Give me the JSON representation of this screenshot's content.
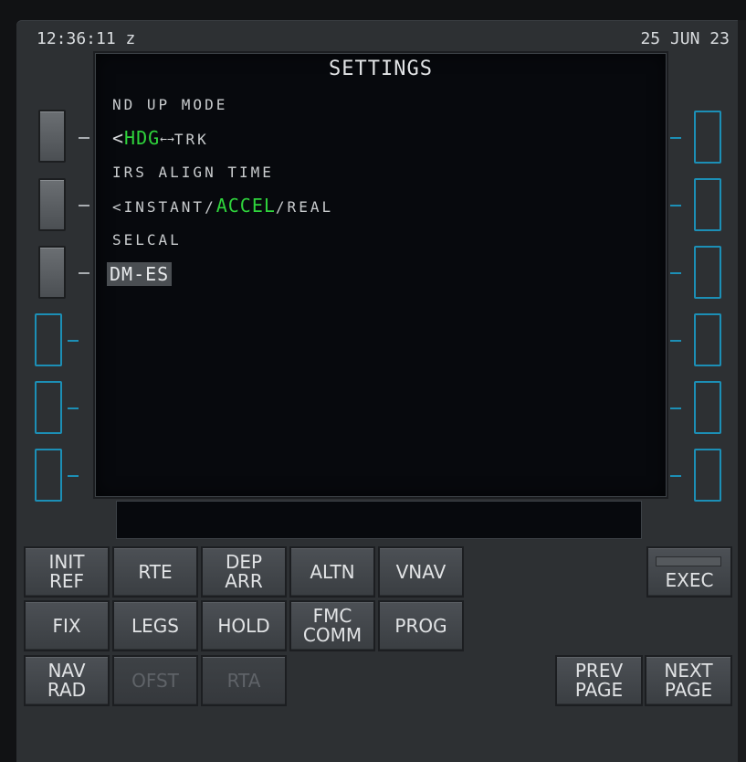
{
  "header": {
    "time": "12:36:11 z",
    "date": "25 JUN 23"
  },
  "screen": {
    "title": "SETTINGS",
    "nd_up_mode_label": "ND UP MODE",
    "nd_prefix": "<",
    "nd_hdg": "HDG",
    "nd_arrow": "←→",
    "nd_trk": "TRK",
    "irs_label": "IRS ALIGN TIME",
    "irs_prefix": "<INSTANT/",
    "irs_accel": "ACCEL",
    "irs_suffix": "/REAL",
    "selcal_label": "SELCAL",
    "selcal_value": "DM-ES"
  },
  "scratchpad": {
    "text": ""
  },
  "keys": {
    "init_ref": "INIT\nREF",
    "rte": "RTE",
    "dep_arr": "DEP\nARR",
    "altn": "ALTN",
    "vnav": "VNAV",
    "exec": "EXEC",
    "fix": "FIX",
    "legs": "LEGS",
    "hold": "HOLD",
    "fmc_comm": "FMC\nCOMM",
    "prog": "PROG",
    "nav_rad": "NAV\nRAD",
    "ofst": "OFST",
    "rta": "RTA",
    "prev_page": "PREV\nPAGE",
    "next_page": "NEXT\nPAGE"
  },
  "colors": {
    "active_green": "#2fd43c",
    "lsk_blue": "#1c8fb6",
    "screen_bg": "#07090d"
  }
}
